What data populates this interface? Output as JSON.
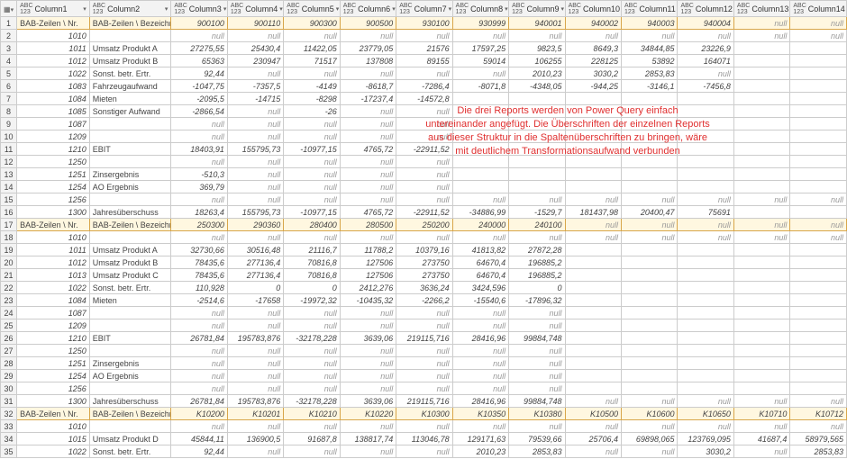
{
  "headers": [
    "Column1",
    "Column2",
    "Column3",
    "Column4",
    "Column5",
    "Column6",
    "Column7",
    "Column8",
    "Column9",
    "Column10",
    "Column11",
    "Column12",
    "Column13",
    "Column14"
  ],
  "hdr_type": "ABC\n123",
  "overlay_l1": "Die drei Reports werden von Power Query einfach",
  "overlay_l2": "untereinander angefügt. Die Überschriften der einzelnen Reports",
  "overlay_l3": "aus dieser Struktur in die Spaltenüberschriften zu bringen, wäre",
  "overlay_l4": "mit deutlichem Transformationsaufwand verbunden",
  "null_label": "null",
  "rows": [
    {
      "n": 1,
      "sec": true,
      "c1": "BAB-Zeilen \\ Nr.",
      "c2": "BAB-Zeilen \\ Bezeichnung kurz",
      "v": [
        "900100",
        "900110",
        "900300",
        "900500",
        "930100",
        "930999",
        "940001",
        "940002",
        "940003",
        "940004",
        "null",
        "null"
      ]
    },
    {
      "n": 2,
      "c1": "1010",
      "c2": "",
      "v": [
        "null",
        "null",
        "null",
        "null",
        "null",
        "null",
        "null",
        "null",
        "null",
        "null",
        "null",
        "null"
      ]
    },
    {
      "n": 3,
      "c1": "1011",
      "c2": "Umsatz Produkt A",
      "v": [
        "27275,55",
        "25430,4",
        "11422,05",
        "23779,05",
        "21576",
        "17597,25",
        "9823,5",
        "8649,3",
        "34844,85",
        "23226,9",
        "",
        ""
      ]
    },
    {
      "n": 4,
      "c1": "1012",
      "c2": "Umsatz Produkt B",
      "v": [
        "65363",
        "230947",
        "71517",
        "137808",
        "89155",
        "59014",
        "106255",
        "228125",
        "53892",
        "164071",
        "",
        ""
      ]
    },
    {
      "n": 5,
      "c1": "1022",
      "c2": "Sonst. betr. Ertr.",
      "v": [
        "92,44",
        "null",
        "null",
        "null",
        "null",
        "null",
        "2010,23",
        "3030,2",
        "2853,83",
        "null",
        "",
        ""
      ]
    },
    {
      "n": 6,
      "c1": "1083",
      "c2": "Fahrzeugaufwand",
      "v": [
        "-1047,75",
        "-7357,5",
        "-4149",
        "-8618,7",
        "-7286,4",
        "-8071,8",
        "-4348,05",
        "-944,25",
        "-3146,1",
        "-7456,8",
        "",
        ""
      ]
    },
    {
      "n": 7,
      "c1": "1084",
      "c2": "Mieten",
      "v": [
        "-2095,5",
        "-14715",
        "-8298",
        "-17237,4",
        "-14572,8",
        "",
        "",
        "",
        "",
        "",
        "",
        ""
      ]
    },
    {
      "n": 8,
      "c1": "1085",
      "c2": "Sonstiger Aufwand",
      "v": [
        "-2866,54",
        "null",
        "-26",
        "null",
        "null",
        "",
        "",
        "",
        "",
        "",
        "",
        ""
      ]
    },
    {
      "n": 9,
      "c1": "1087",
      "c2": "",
      "v": [
        "null",
        "null",
        "null",
        "null",
        "null",
        "",
        "",
        "",
        "",
        "",
        "",
        ""
      ]
    },
    {
      "n": 10,
      "c1": "1209",
      "c2": "",
      "v": [
        "null",
        "null",
        "null",
        "null",
        "null",
        "",
        "",
        "",
        "",
        "",
        "",
        ""
      ]
    },
    {
      "n": 11,
      "c1": "1210",
      "c2": "EBIT",
      "v": [
        "18403,91",
        "155795,73",
        "-10977,15",
        "4765,72",
        "-22911,52",
        "",
        "",
        "",
        "",
        "",
        "",
        ""
      ]
    },
    {
      "n": 12,
      "c1": "1250",
      "c2": "",
      "v": [
        "null",
        "null",
        "null",
        "null",
        "null",
        "",
        "",
        "",
        "",
        "",
        "",
        ""
      ]
    },
    {
      "n": 13,
      "c1": "1251",
      "c2": "Zinsergebnis",
      "v": [
        "-510,3",
        "null",
        "null",
        "null",
        "null",
        "",
        "",
        "",
        "",
        "",
        "",
        ""
      ]
    },
    {
      "n": 14,
      "c1": "1254",
      "c2": "AO Ergebnis",
      "v": [
        "369,79",
        "null",
        "null",
        "null",
        "null",
        "",
        "",
        "",
        "",
        "",
        "",
        ""
      ]
    },
    {
      "n": 15,
      "c1": "1256",
      "c2": "",
      "v": [
        "null",
        "null",
        "null",
        "null",
        "null",
        "null",
        "null",
        "null",
        "null",
        "null",
        "null",
        "null"
      ]
    },
    {
      "n": 16,
      "c1": "1300",
      "c2": "Jahresüberschuss",
      "v": [
        "18263,4",
        "155795,73",
        "-10977,15",
        "4765,72",
        "-22911,52",
        "-34886,99",
        "-1529,7",
        "181437,98",
        "20400,47",
        "75691",
        "",
        ""
      ]
    },
    {
      "n": 17,
      "sec": true,
      "c1": "BAB-Zeilen \\ Nr.",
      "c2": "BAB-Zeilen \\ Bezeichnung kurz",
      "v": [
        "250300",
        "290360",
        "280400",
        "280500",
        "250200",
        "240000",
        "240100",
        "null",
        "null",
        "null",
        "null",
        "null"
      ]
    },
    {
      "n": 18,
      "c1": "1010",
      "c2": "",
      "v": [
        "null",
        "null",
        "null",
        "null",
        "null",
        "null",
        "null",
        "null",
        "null",
        "null",
        "null",
        "null"
      ]
    },
    {
      "n": 19,
      "c1": "1011",
      "c2": "Umsatz Produkt A",
      "v": [
        "32730,66",
        "30516,48",
        "21116,7",
        "11788,2",
        "10379,16",
        "41813,82",
        "27872,28",
        "",
        "",
        "",
        "",
        ""
      ]
    },
    {
      "n": 20,
      "c1": "1012",
      "c2": "Umsatz Produkt B",
      "v": [
        "78435,6",
        "277136,4",
        "70816,8",
        "127506",
        "273750",
        "64670,4",
        "196885,2",
        "",
        "",
        "",
        "",
        ""
      ]
    },
    {
      "n": 21,
      "c1": "1013",
      "c2": "Umsatz Produkt C",
      "v": [
        "78435,6",
        "277136,4",
        "70816,8",
        "127506",
        "273750",
        "64670,4",
        "196885,2",
        "",
        "",
        "",
        "",
        ""
      ]
    },
    {
      "n": 22,
      "c1": "1022",
      "c2": "Sonst. betr. Ertr.",
      "v": [
        "110,928",
        "0",
        "0",
        "2412,276",
        "3636,24",
        "3424,596",
        "0",
        "",
        "",
        "",
        "",
        ""
      ]
    },
    {
      "n": 23,
      "c1": "1084",
      "c2": "Mieten",
      "v": [
        "-2514,6",
        "-17658",
        "-19972,32",
        "-10435,32",
        "-2266,2",
        "-15540,6",
        "-17896,32",
        "",
        "",
        "",
        "",
        ""
      ]
    },
    {
      "n": 24,
      "c1": "1087",
      "c2": "",
      "v": [
        "null",
        "null",
        "null",
        "null",
        "null",
        "null",
        "null",
        "",
        "",
        "",
        "",
        ""
      ]
    },
    {
      "n": 25,
      "c1": "1209",
      "c2": "",
      "v": [
        "null",
        "null",
        "null",
        "null",
        "null",
        "null",
        "null",
        "",
        "",
        "",
        "",
        ""
      ]
    },
    {
      "n": 26,
      "c1": "1210",
      "c2": "EBIT",
      "v": [
        "26781,84",
        "195783,876",
        "-32178,228",
        "3639,06",
        "219115,716",
        "28416,96",
        "99884,748",
        "",
        "",
        "",
        "",
        ""
      ]
    },
    {
      "n": 27,
      "c1": "1250",
      "c2": "",
      "v": [
        "null",
        "null",
        "null",
        "null",
        "null",
        "null",
        "null",
        "",
        "",
        "",
        "",
        ""
      ]
    },
    {
      "n": 28,
      "c1": "1251",
      "c2": "Zinsergebnis",
      "v": [
        "null",
        "null",
        "null",
        "null",
        "null",
        "null",
        "null",
        "",
        "",
        "",
        "",
        ""
      ]
    },
    {
      "n": 29,
      "c1": "1254",
      "c2": "AO Ergebnis",
      "v": [
        "null",
        "null",
        "null",
        "null",
        "null",
        "null",
        "null",
        "",
        "",
        "",
        "",
        ""
      ]
    },
    {
      "n": 30,
      "c1": "1256",
      "c2": "",
      "v": [
        "null",
        "null",
        "null",
        "null",
        "null",
        "null",
        "null",
        "",
        "",
        "",
        "",
        ""
      ]
    },
    {
      "n": 31,
      "c1": "1300",
      "c2": "Jahresüberschuss",
      "v": [
        "26781,84",
        "195783,876",
        "-32178,228",
        "3639,06",
        "219115,716",
        "28416,96",
        "99884,748",
        "null",
        "null",
        "null",
        "null",
        "null"
      ]
    },
    {
      "n": 32,
      "sec": true,
      "c1": "BAB-Zeilen \\ Nr.",
      "c2": "BAB-Zeilen \\ Bezeichnung kurz",
      "v": [
        "K10200",
        "K10201",
        "K10210",
        "K10220",
        "K10300",
        "K10350",
        "K10380",
        "K10500",
        "K10600",
        "K10650",
        "K10710",
        "K10712"
      ]
    },
    {
      "n": 33,
      "c1": "1010",
      "c2": "",
      "v": [
        "null",
        "null",
        "null",
        "null",
        "null",
        "null",
        "null",
        "null",
        "null",
        "null",
        "null",
        "null"
      ]
    },
    {
      "n": 34,
      "c1": "1015",
      "c2": "Umsatz Produkt D",
      "v": [
        "45844,11",
        "136900,5",
        "91687,8",
        "138817,74",
        "113046,78",
        "129171,63",
        "79539,66",
        "25706,4",
        "69898,065",
        "123769,095",
        "41687,4",
        "58979,565"
      ]
    },
    {
      "n": 35,
      "c1": "1022",
      "c2": "Sonst. betr. Ertr.",
      "v": [
        "92,44",
        "null",
        "null",
        "null",
        "null",
        "2010,23",
        "2853,83",
        "null",
        "null",
        "3030,2",
        "null",
        "2853,83"
      ]
    }
  ]
}
